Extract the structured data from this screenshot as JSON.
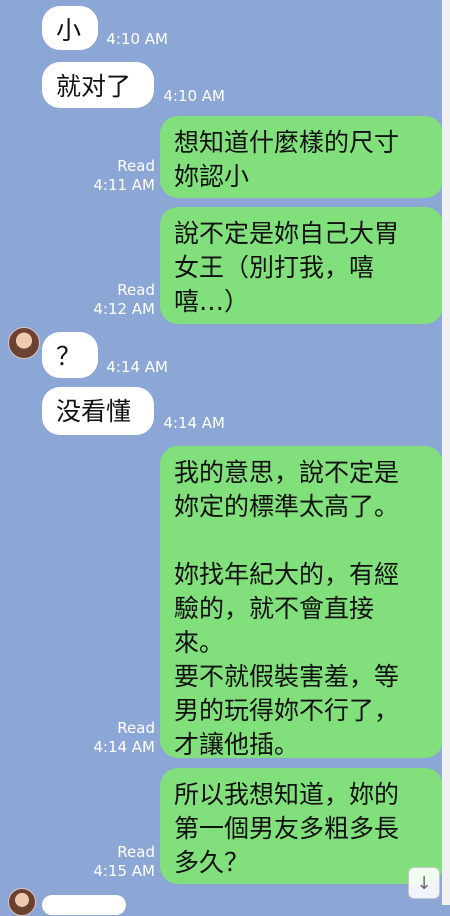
{
  "messages": [
    {
      "text": "小",
      "time": "4:10 AM"
    },
    {
      "text": "就对了",
      "time": "4:10 AM"
    },
    {
      "text": "想知道什麼樣的尺寸\n妳認小",
      "status": "Read",
      "time": "4:11 AM"
    },
    {
      "text": "說不定是妳自己大胃\n女王（別打我，嘻\n嘻…）",
      "status": "Read",
      "time": "4:12 AM"
    },
    {
      "text": "？",
      "time": "4:14 AM"
    },
    {
      "text": "没看懂",
      "time": "4:14 AM"
    },
    {
      "text": "我的意思，說不定是\n妳定的標準太高了。\n\n妳找年紀大的，有經\n驗的，就不會直接\n來。\n要不就假裝害羞，等\n男的玩得妳不行了，\n才讓他插。",
      "status": "Read",
      "time": "4:14 AM"
    },
    {
      "text": "所以我想知道，妳的\n第一個男友多粗多長\n多久？",
      "status": "Read",
      "time": "4:15 AM"
    }
  ],
  "scroll_button": {
    "icon": "arrow-down-icon",
    "glyph": "↓"
  },
  "avatar_icon": "contact-avatar-icon"
}
